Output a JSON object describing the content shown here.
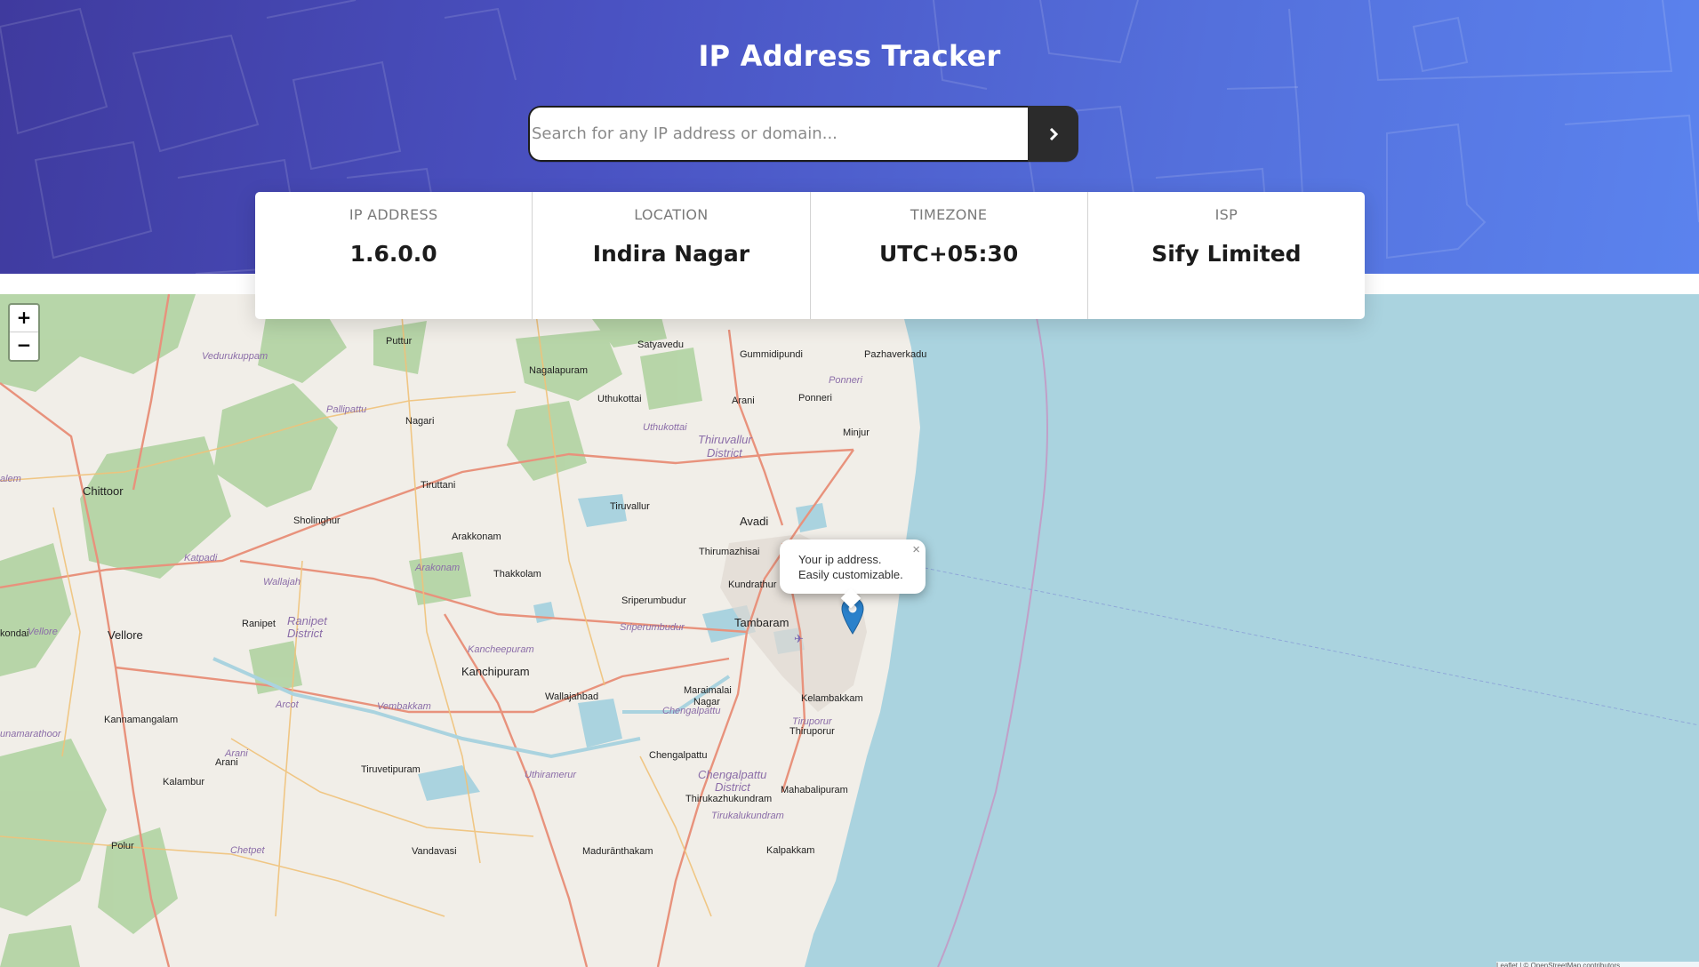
{
  "header": {
    "title": "IP Address Tracker",
    "search_placeholder": "Search for any IP address or domain...",
    "search_value": "",
    "submit_icon": "chevron-right-icon"
  },
  "info": [
    {
      "label": "IP ADDRESS",
      "value": "1.6.0.0"
    },
    {
      "label": "LOCATION",
      "value": "Indira Nagar"
    },
    {
      "label": "TIMEZONE",
      "value": "UTC+05:30"
    },
    {
      "label": "ISP",
      "value": "Sify Limited"
    }
  ],
  "map": {
    "zoom_in": "+",
    "zoom_out": "−",
    "popup_line1": "Your ip address.",
    "popup_line2": "Easily customizable.",
    "popup_close": "×",
    "attribution": "Leaflet | © OpenStreetMap contributors",
    "places": [
      "Puttur",
      "Satyavedu",
      "Gummidipundi",
      "Pazhaverkadu",
      "Nagalapuram",
      "Uthukottai",
      "Arani",
      "Ponneri",
      "Nagari",
      "Minjur",
      "Chittoor",
      "Tiruttani",
      "Tiruvallur",
      "Avadi",
      "Sholinghur",
      "Arakkonam",
      "Thirumazhisai",
      "Thakkolam",
      "Kundrathur",
      "Sriperumbudur",
      "Tambaram",
      "Ranipet",
      "Vellore",
      "Kanchipuram",
      "Wallajahbad",
      "Maraimalai",
      "Nagar",
      "Kelambakkam",
      "Kannamangalam",
      "Thiruporur",
      "Chengalpattu",
      "Arani",
      "Tiruvetipuram",
      "Kalambur",
      "Mahabalipuram",
      "Thirukazhukundram",
      "Polur",
      "Vandavasi",
      "Madurānthakam",
      "Kalpakkam",
      "kondai"
    ],
    "districts": [
      "Vedurukuppam",
      "Ponneri",
      "Uthukottai",
      "Thiruvallur",
      "District",
      "Pallipattu",
      "Katpadi",
      "Wallajah",
      "Arakonam",
      "Ranipet",
      "District",
      "Sriperumbudur",
      "Kancheepuram",
      "Vellore",
      "Arcot",
      "Vembakkam",
      "Chengalpattu",
      "Tiruporur",
      "Arani",
      "Uthiramerur",
      "Chengalpattu",
      "District",
      "Tirukalukundram",
      "Chetpet",
      "alem",
      "unamarathoor"
    ],
    "colors": {
      "sea": "#aad3df",
      "land": "#f1eee8",
      "forest": "#add19e",
      "road_major": "#e8927c",
      "road_minor": "#f7d68e",
      "marker": "#2a81cb"
    }
  }
}
